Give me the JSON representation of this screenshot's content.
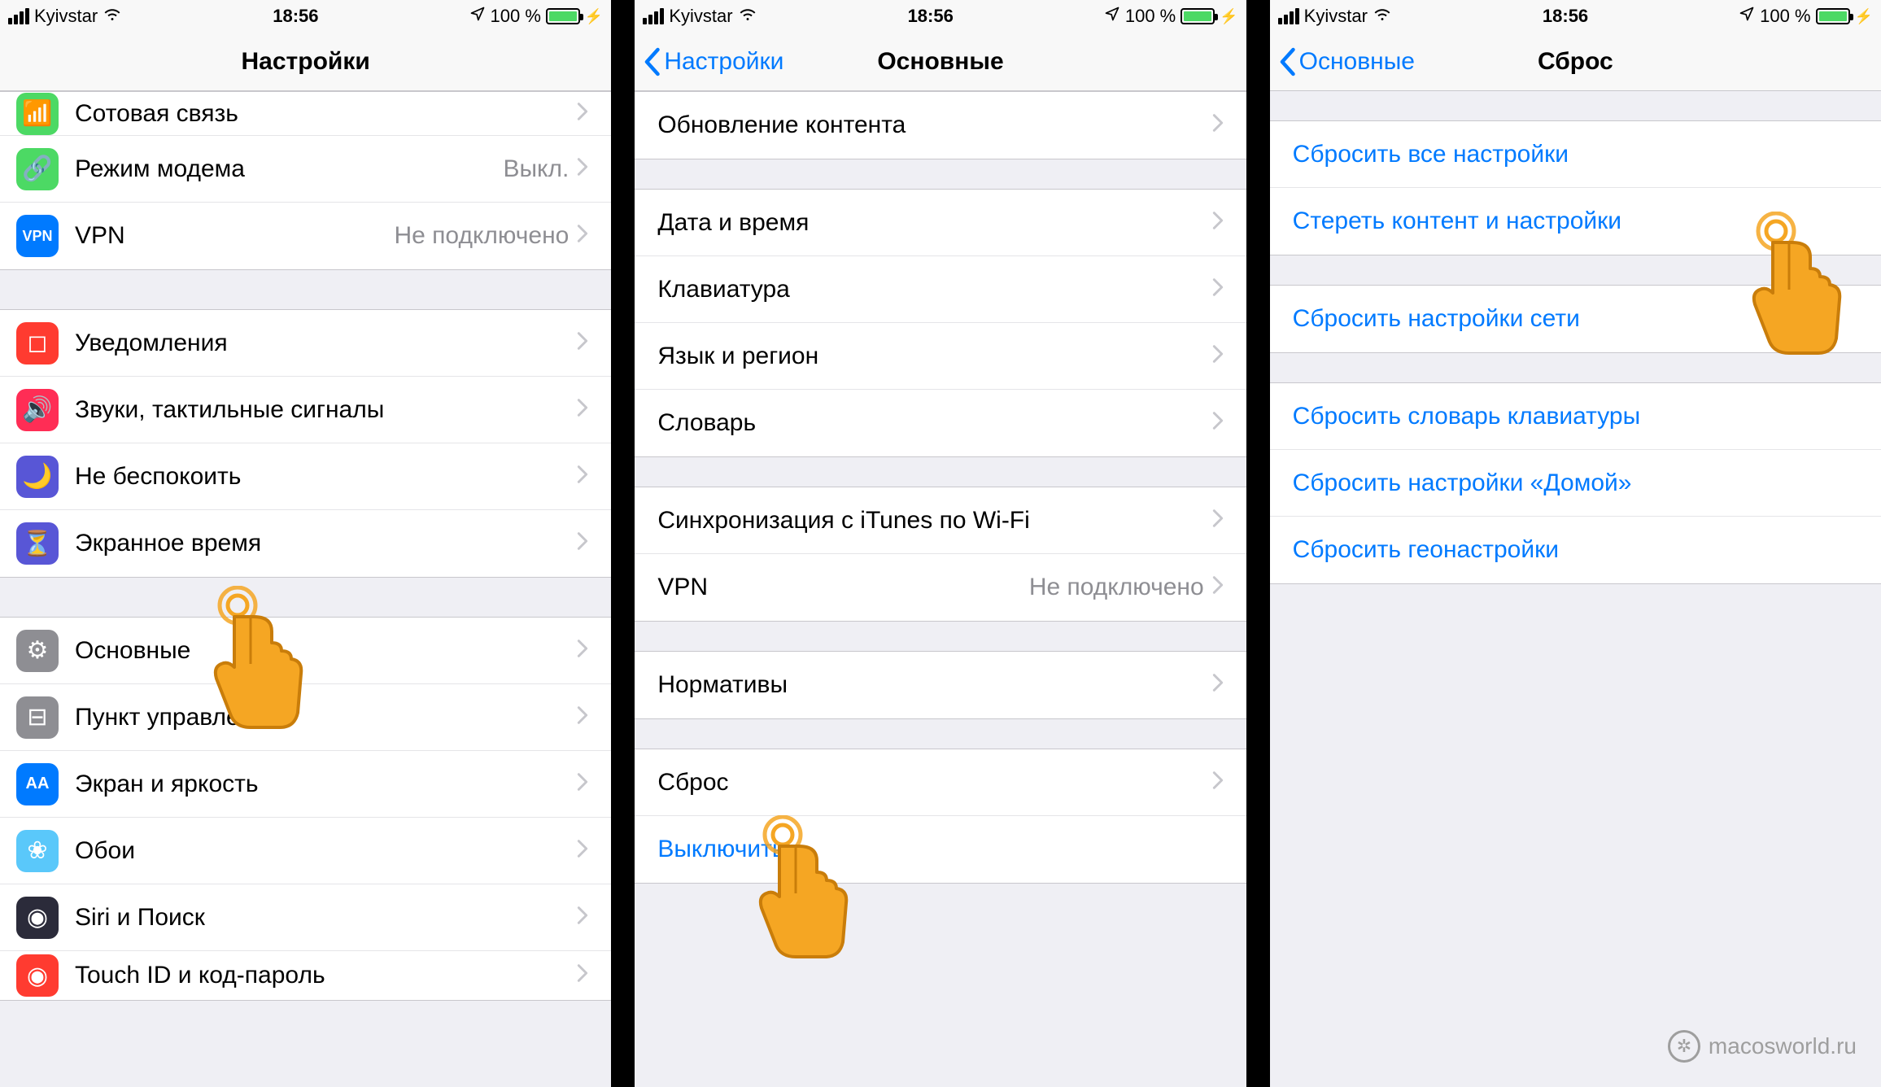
{
  "statusbar": {
    "carrier": "Kyivstar",
    "time": "18:56",
    "battery_text": "100 %"
  },
  "screen1": {
    "title": "Настройки",
    "rows_a": [
      {
        "label": "Сотовая связь",
        "icon": "antenna",
        "bg": "#4cd964"
      },
      {
        "label": "Режим модема",
        "value": "Выкл.",
        "icon": "link",
        "bg": "#4cd964"
      },
      {
        "label": "VPN",
        "value": "Не подключено",
        "icon": "vpn",
        "bg": "#007aff",
        "vpntext": "VPN"
      }
    ],
    "rows_b": [
      {
        "label": "Уведомления",
        "icon": "bell",
        "bg": "#ff3b30"
      },
      {
        "label": "Звуки, тактильные сигналы",
        "icon": "speaker",
        "bg": "#ff2d55"
      },
      {
        "label": "Не беспокоить",
        "icon": "moon",
        "bg": "#5856d6"
      },
      {
        "label": "Экранное время",
        "icon": "hourglass",
        "bg": "#5856d6"
      }
    ],
    "rows_c": [
      {
        "label": "Основные",
        "icon": "gear",
        "bg": "#8e8e93"
      },
      {
        "label": "Пункт управления",
        "icon": "toggles",
        "bg": "#8e8e93"
      },
      {
        "label": "Экран и яркость",
        "icon": "AA",
        "bg": "#007aff",
        "text": "AA"
      },
      {
        "label": "Обои",
        "icon": "flower",
        "bg": "#5ac8fa"
      },
      {
        "label": "Siri и Поиск",
        "icon": "siri",
        "bg": "#000"
      },
      {
        "label": "Touch ID и код-пароль",
        "icon": "finger",
        "bg": "#ff3b30"
      }
    ]
  },
  "screen2": {
    "back": "Настройки",
    "title": "Основные",
    "rows_a": [
      {
        "label": "Обновление контента"
      }
    ],
    "rows_b": [
      {
        "label": "Дата и время"
      },
      {
        "label": "Клавиатура"
      },
      {
        "label": "Язык и регион"
      },
      {
        "label": "Словарь"
      }
    ],
    "rows_c": [
      {
        "label": "Синхронизация с iTunes по Wi-Fi"
      },
      {
        "label": "VPN",
        "value": "Не подключено"
      }
    ],
    "rows_d": [
      {
        "label": "Нормативы"
      }
    ],
    "rows_e": [
      {
        "label": "Сброс"
      },
      {
        "label": "Выключить",
        "link": true,
        "nochev": true
      }
    ]
  },
  "screen3": {
    "back": "Основные",
    "title": "Сброс",
    "rows_a": [
      {
        "label": "Сбросить все настройки"
      },
      {
        "label": "Стереть контент и настройки"
      }
    ],
    "rows_b": [
      {
        "label": "Сбросить настройки сети"
      }
    ],
    "rows_c": [
      {
        "label": "Сбросить словарь клавиатуры"
      },
      {
        "label": "Сбросить настройки «Домой»"
      },
      {
        "label": "Сбросить геонастройки"
      }
    ]
  },
  "watermark": "macosworld.ru"
}
